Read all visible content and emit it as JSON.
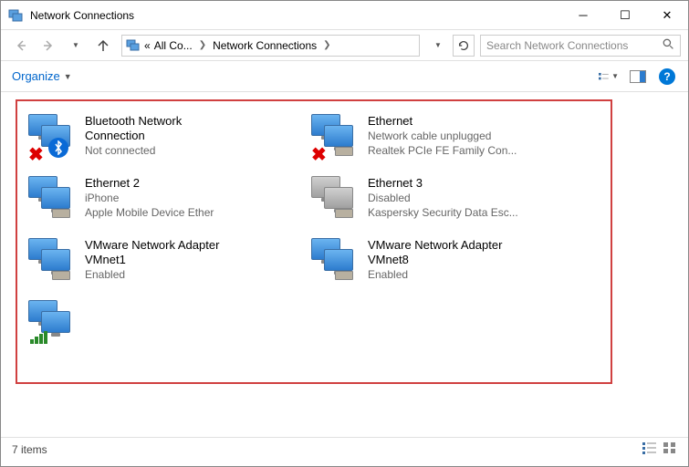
{
  "window": {
    "title": "Network Connections"
  },
  "breadcrumb": {
    "cue": "«",
    "seg1": "All Co...",
    "seg2": "Network Connections"
  },
  "search": {
    "placeholder": "Search Network Connections"
  },
  "toolbar": {
    "organize_label": "Organize"
  },
  "adapters": [
    {
      "name": "Bluetooth Network",
      "name2": "Connection",
      "status": "Not connected",
      "device": "",
      "icon": "bluetooth",
      "disabled": false,
      "x": true
    },
    {
      "name": "Ethernet",
      "name2": "",
      "status": "Network cable unplugged",
      "device": "Realtek PCIe FE Family Con...",
      "icon": "ethernet",
      "disabled": false,
      "x": true
    },
    {
      "name": "Ethernet 2",
      "name2": "",
      "status": "iPhone",
      "device": "Apple Mobile Device Ether",
      "icon": "ethernet",
      "disabled": false,
      "x": false
    },
    {
      "name": "Ethernet 3",
      "name2": "",
      "status": "Disabled",
      "device": "Kaspersky Security Data Esc...",
      "icon": "ethernet",
      "disabled": true,
      "x": false
    },
    {
      "name": "VMware Network Adapter",
      "name2": "VMnet1",
      "status": "Enabled",
      "device": "",
      "icon": "ethernet",
      "disabled": false,
      "x": false
    },
    {
      "name": "VMware Network Adapter",
      "name2": "VMnet8",
      "status": "Enabled",
      "device": "",
      "icon": "ethernet",
      "disabled": false,
      "x": false
    },
    {
      "name": "",
      "name2": "",
      "status": "",
      "device": "",
      "icon": "wifi",
      "disabled": false,
      "x": false
    }
  ],
  "statusbar": {
    "count_text": "7 items"
  }
}
